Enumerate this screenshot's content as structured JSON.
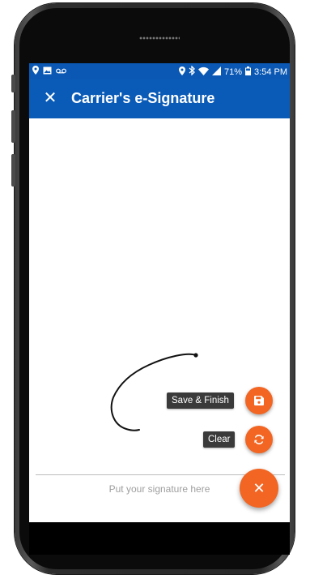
{
  "statusbar": {
    "battery": "71%",
    "time": "3:54 PM",
    "left_icons": [
      "location-icon",
      "image-icon",
      "voicemail-icon"
    ],
    "right_icons": [
      "location-icon",
      "bluetooth-icon",
      "wifi-icon",
      "signal-icon",
      "battery-icon"
    ]
  },
  "appbar": {
    "close_symbol": "✕",
    "title": "Carrier's e-Signature"
  },
  "signature": {
    "hint": "Put your signature here"
  },
  "actions": {
    "save_label": "Save & Finish",
    "clear_label": "Clear",
    "main_symbol": "✕"
  },
  "colors": {
    "primary": "#0a5bb7",
    "accent": "#f26522",
    "tooltip": "#3a3a3a"
  }
}
